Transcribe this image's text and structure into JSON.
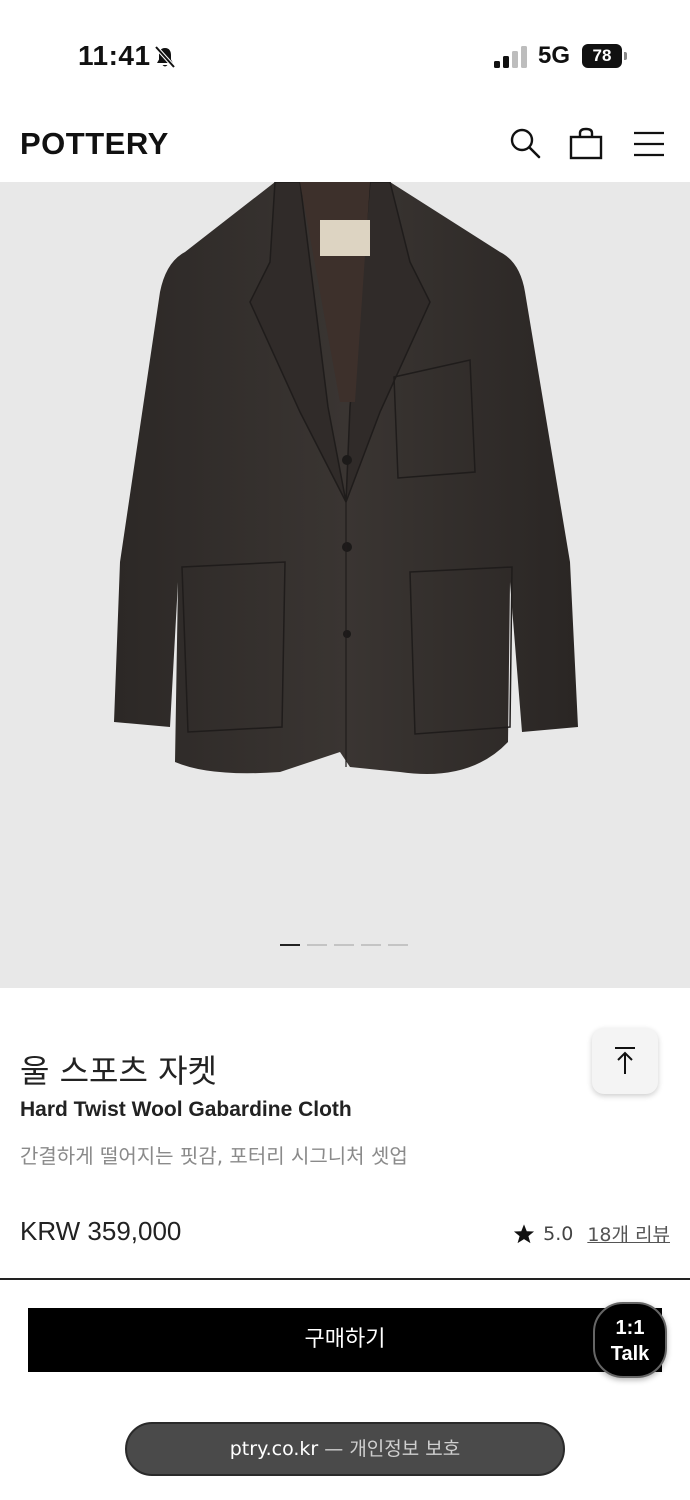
{
  "status_bar": {
    "time": "11:41",
    "network": "5G",
    "battery": "78"
  },
  "header": {
    "logo": "POTTERY",
    "icons": [
      "search-icon",
      "shopping-bag-icon",
      "hamburger-menu-icon"
    ]
  },
  "gallery": {
    "slide_count": 5,
    "active_slide": 1
  },
  "product": {
    "name_ko": "울 스포츠 자켓",
    "name_en": "Hard Twist Wool Gabardine Cloth",
    "description": "간결하게 떨어지는 핏감, 포터리 시그니처 셋업",
    "price": "KRW 359,000",
    "rating": "5.0",
    "review_count_label": "18개 리뷰"
  },
  "actions": {
    "buy_label": "구매하기",
    "talk_line1": "1:1",
    "talk_line2": "Talk"
  },
  "url_bar": {
    "domain": "ptry.co.kr",
    "suffix": " — 개인정보 보호"
  },
  "colors": {
    "image_background": "#e8e8e8",
    "button_black": "#000000",
    "muted_text": "#8a8a8a"
  }
}
